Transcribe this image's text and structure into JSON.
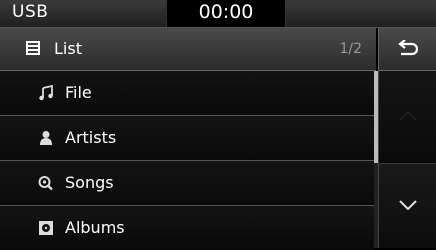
{
  "status": {
    "source": "USB",
    "clock": "00:00"
  },
  "header": {
    "title": "List",
    "page": "1/2",
    "icon": "list-icon",
    "back_icon": "back-arrow-icon"
  },
  "list": [
    {
      "label": "File",
      "icon": "music-note-icon"
    },
    {
      "label": "Artists",
      "icon": "person-icon"
    },
    {
      "label": "Songs",
      "icon": "search-note-icon"
    },
    {
      "label": "Albums",
      "icon": "album-icon"
    }
  ],
  "scroll": {
    "up_icon": "chevron-up-icon",
    "down_icon": "chevron-down-icon",
    "position_fraction": 0.5
  }
}
